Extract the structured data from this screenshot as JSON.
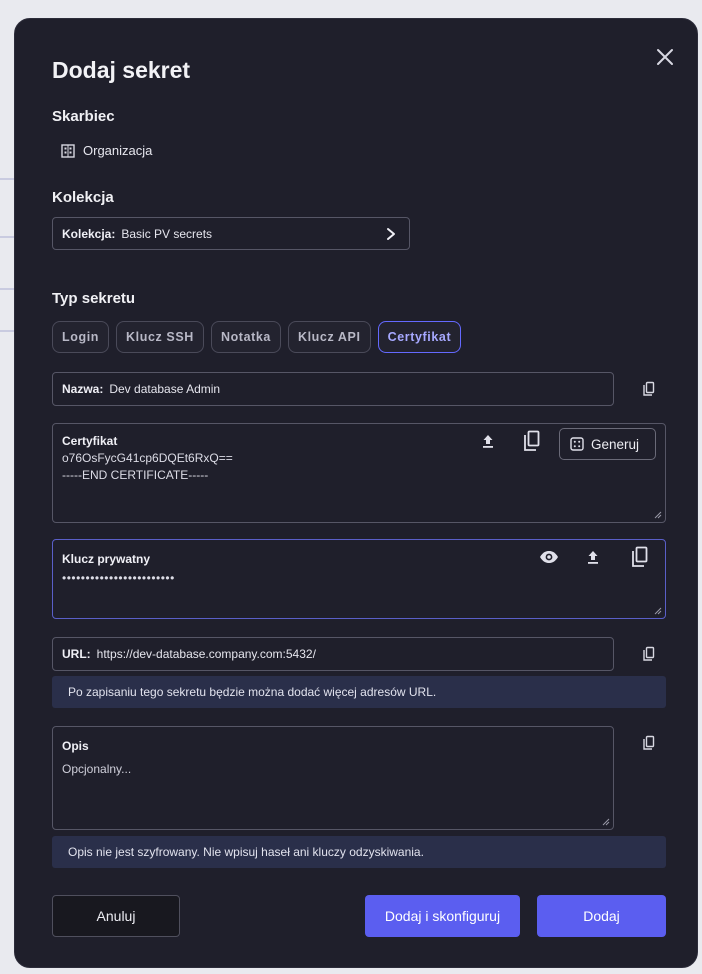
{
  "dialog": {
    "title": "Dodaj sekret"
  },
  "vault": {
    "label": "Skarbiec",
    "value": "Organizacja",
    "icon": "building-icon"
  },
  "collection": {
    "label": "Kolekcja",
    "field_label": "Kolekcja:",
    "field_value": "Basic PV secrets"
  },
  "secret_type": {
    "label": "Typ sekretu",
    "options": [
      "Login",
      "Klucz SSH",
      "Notatka",
      "Klucz API",
      "Certyfikat"
    ],
    "selected": "Certyfikat"
  },
  "name_field": {
    "label": "Nazwa:",
    "value": "Dev database Admin"
  },
  "certificate": {
    "label": "Certyfikat",
    "value": "o76OsFycG41cp6DQEt6RxQ==\n-----END CERTIFICATE-----",
    "generate_label": "Generuj"
  },
  "private_key": {
    "label": "Klucz prywatny",
    "value": "••••••••••••••••••••••••"
  },
  "url_field": {
    "label": "URL:",
    "value": "https://dev-database.company.com:5432/",
    "info": "Po zapisaniu tego sekretu będzie można dodać więcej adresów URL."
  },
  "description": {
    "label": "Opis",
    "placeholder": "Opcjonalny...",
    "info": "Opis nie jest szyfrowany. Nie wpisuj haseł ani kluczy odzyskiwania."
  },
  "buttons": {
    "cancel": "Anuluj",
    "add_and_configure": "Dodaj i skonfiguruj",
    "add": "Dodaj"
  },
  "colors": {
    "background": "#1f1f2b",
    "accent": "#5b5ef0",
    "info_box": "#2a2f4a"
  }
}
